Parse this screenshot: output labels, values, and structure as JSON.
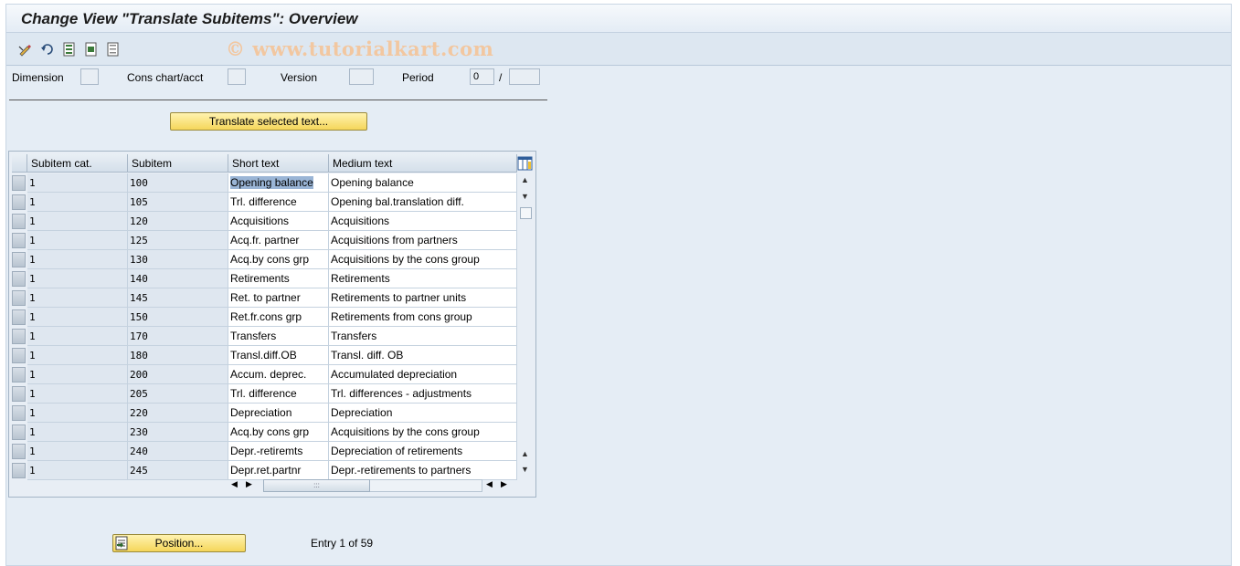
{
  "window": {
    "title": "Change View \"Translate Subitems\": Overview"
  },
  "toolbar": {
    "icons": [
      "change-display-icon",
      "undo-icon",
      "select-all-icon",
      "select-block-icon",
      "deselect-all-icon"
    ],
    "watermark": "© www.tutorialkart.com"
  },
  "header": {
    "dimension_label": "Dimension",
    "dimension_value": "",
    "cons_chart_label": "Cons chart/acct",
    "cons_chart_value": "",
    "version_label": "Version",
    "version_value": "",
    "period_label": "Period",
    "period_value": "0",
    "period_sep": "/",
    "year_value": ""
  },
  "actions": {
    "translate_label": "Translate selected text...",
    "position_label": "Position..."
  },
  "table": {
    "columns": [
      "Subitem cat.",
      "Subitem",
      "Short text",
      "Medium text"
    ],
    "rows": [
      {
        "cat": "1",
        "item": "100",
        "short": "Opening balance",
        "medium": "Opening balance"
      },
      {
        "cat": "1",
        "item": "105",
        "short": "Trl. difference",
        "medium": "Opening bal.translation diff."
      },
      {
        "cat": "1",
        "item": "120",
        "short": "Acquisitions",
        "medium": "Acquisitions"
      },
      {
        "cat": "1",
        "item": "125",
        "short": "Acq.fr. partner",
        "medium": "Acquisitions from partners"
      },
      {
        "cat": "1",
        "item": "130",
        "short": "Acq.by cons grp",
        "medium": "Acquisitions by the cons group"
      },
      {
        "cat": "1",
        "item": "140",
        "short": "Retirements",
        "medium": "Retirements"
      },
      {
        "cat": "1",
        "item": "145",
        "short": "Ret. to partner",
        "medium": "Retirements to partner units"
      },
      {
        "cat": "1",
        "item": "150",
        "short": "Ret.fr.cons grp",
        "medium": "Retirements from cons group"
      },
      {
        "cat": "1",
        "item": "170",
        "short": "Transfers",
        "medium": "Transfers"
      },
      {
        "cat": "1",
        "item": "180",
        "short": "Transl.diff.OB",
        "medium": "Transl. diff. OB"
      },
      {
        "cat": "1",
        "item": "200",
        "short": "Accum. deprec.",
        "medium": "Accumulated depreciation"
      },
      {
        "cat": "1",
        "item": "205",
        "short": "Trl. difference",
        "medium": "Trl. differences - adjustments"
      },
      {
        "cat": "1",
        "item": "220",
        "short": "Depreciation",
        "medium": "Depreciation"
      },
      {
        "cat": "1",
        "item": "230",
        "short": "Acq.by cons grp",
        "medium": "Acquisitions by the cons group"
      },
      {
        "cat": "1",
        "item": "240",
        "short": "Depr.-retiremts",
        "medium": "Depreciation of retirements"
      },
      {
        "cat": "1",
        "item": "245",
        "short": "Depr.ret.partnr",
        "medium": "Depr.-retirements to partners"
      }
    ]
  },
  "status": {
    "entry_text": "Entry 1 of 59"
  }
}
